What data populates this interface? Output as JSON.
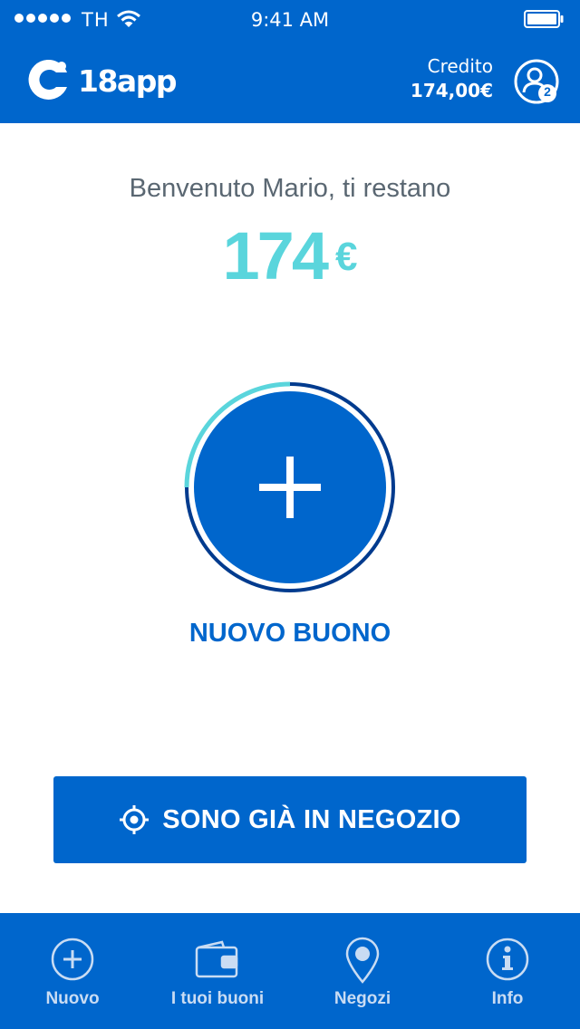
{
  "status_bar": {
    "carrier": "TH",
    "time": "9:41 AM"
  },
  "header": {
    "brand": "18app",
    "credit_label": "Credito",
    "credit_value": "174,00€",
    "profile_badge": "2"
  },
  "main": {
    "welcome": "Benvenuto Mario, ti restano",
    "balance_amount": "174",
    "balance_currency": "€",
    "new_voucher_label": "NUOVO BUONO",
    "in_store_label": "SONO GIÀ IN NEGOZIO"
  },
  "tabs": [
    {
      "label": "Nuovo",
      "icon": "plus-circle-icon"
    },
    {
      "label": "I tuoi buoni",
      "icon": "wallet-icon"
    },
    {
      "label": "Negozi",
      "icon": "map-pin-icon"
    },
    {
      "label": "Info",
      "icon": "info-circle-icon"
    }
  ],
  "colors": {
    "primary": "#0066cc",
    "accent": "#5ad5dc",
    "ring_dark": "#003b8e",
    "text_gray": "#5a6772"
  }
}
